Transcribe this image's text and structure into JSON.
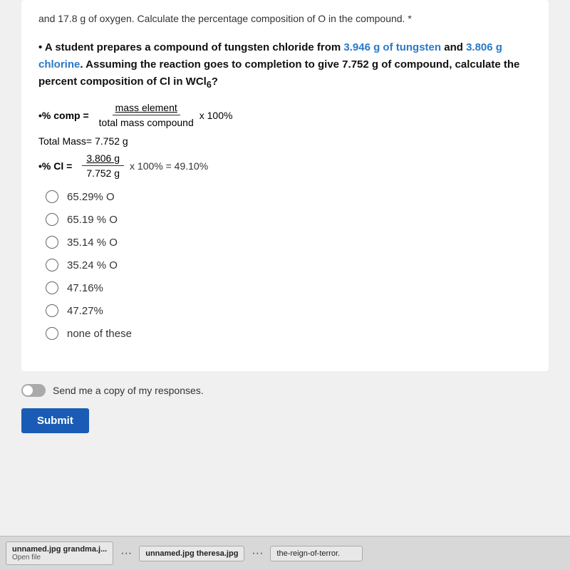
{
  "top": {
    "text": "and 17.8 g of oxygen. Calculate the percentage composition of O in the compound. *"
  },
  "question": {
    "bullet": "•",
    "text_part1": "A student prepares a compound of tungsten chloride from ",
    "text_blue1": "3.946 g of tungsten",
    "text_part2": " and ",
    "text_blue2": "3.806 g chlorine",
    "text_part3": ". Assuming the reaction goes to completion to give 7.752 g of compound, calculate the percent composition of Cl in WCl",
    "subscript": "6",
    "text_part4": "?"
  },
  "formula": {
    "label": "•% comp =",
    "numerator": "mass element",
    "denominator": "total mass compound",
    "multiplier": "x 100%"
  },
  "total_mass": {
    "label": "Total Mass= 7.752 g"
  },
  "percent_cl": {
    "label": "•% Cl =",
    "numerator": "3.806 g",
    "denominator": "7.752 g",
    "multiplier": "x 100% = 49.10%"
  },
  "options": [
    {
      "id": "opt1",
      "label": "65.29% O"
    },
    {
      "id": "opt2",
      "label": "65.19 % O"
    },
    {
      "id": "opt3",
      "label": "35.14 % O"
    },
    {
      "id": "opt4",
      "label": "35.24 % O"
    },
    {
      "id": "opt5",
      "label": "47.16%"
    },
    {
      "id": "opt6",
      "label": "47.27%"
    },
    {
      "id": "opt7",
      "label": "none of these"
    }
  ],
  "send_copy": {
    "label": "Send me a copy of my responses."
  },
  "submit_button": {
    "label": "Submit"
  },
  "taskbar": {
    "item1_name": "unnamed.jpg grandma.j...",
    "item1_sub": "Open file",
    "item2_name": "unnamed.jpg theresa.jpg",
    "item2_sub": "",
    "item3_name": "the-reign-of-terror.",
    "item3_sub": ""
  }
}
